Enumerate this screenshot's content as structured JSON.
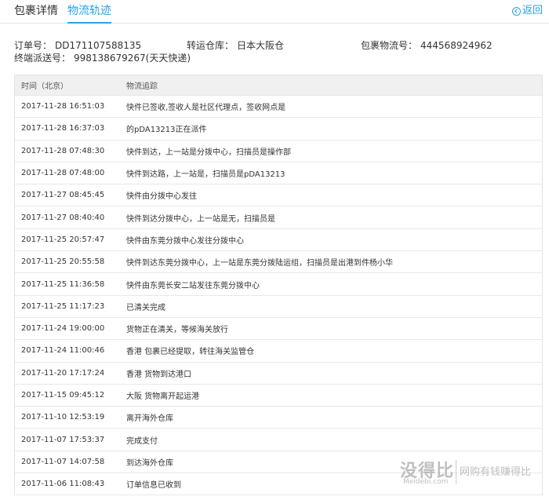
{
  "tabs": [
    {
      "label": "包裹详情"
    },
    {
      "label": "物流轨迹"
    }
  ],
  "back_label": "返回",
  "info": {
    "order_label": "订单号：",
    "order_value": "DD171107588135",
    "warehouse_label": "转运仓库：",
    "warehouse_value": "日本大阪仓",
    "package_label": "包裹物流号：",
    "package_value": "444568924962",
    "terminal_label": "终端派送号：",
    "terminal_value": "998138679267(天天快递)"
  },
  "table": {
    "headers": {
      "time": "时间（北京）",
      "desc": "物流追踪"
    },
    "rows": [
      {
        "time": "2017-11-28 16:51:03",
        "desc": "快件已签收,签收人是社区代理点，签收网点是"
      },
      {
        "time": "2017-11-28 16:37:03",
        "desc": "的pDA13213正在派件"
      },
      {
        "time": "2017-11-28 07:48:30",
        "desc": "快件到达，上一站是分拨中心，扫描员是操作部"
      },
      {
        "time": "2017-11-28 07:48:00",
        "desc": "快件到达路，上一站是，扫描员是pDA13213"
      },
      {
        "time": "2017-11-27 08:45:45",
        "desc": "快件由分拨中心发往"
      },
      {
        "time": "2017-11-27 08:40:40",
        "desc": "快件到达分拨中心，上一站是无，扫描员是"
      },
      {
        "time": "2017-11-25 20:57:47",
        "desc": "快件由东莞分拨中心发往分拨中心"
      },
      {
        "time": "2017-11-25 20:55:58",
        "desc": "快件到达东莞分拨中心，上一站是东莞分拨陆运组，扫描员是出港到件杨小华"
      },
      {
        "time": "2017-11-25 11:36:58",
        "desc": "快件由东莞长安二站发往东莞分拨中心"
      },
      {
        "time": "2017-11-25 11:17:23",
        "desc": "已清关完成"
      },
      {
        "time": "2017-11-24 19:00:00",
        "desc": "货物正在清关，等候海关放行"
      },
      {
        "time": "2017-11-24 11:00:46",
        "desc": "香港 包裹已经提取，转往海关监管仓"
      },
      {
        "time": "2017-11-20 17:17:24",
        "desc": "香港 货物到达港口"
      },
      {
        "time": "2017-11-15 09:45:12",
        "desc": "大阪 货物离开起运港"
      },
      {
        "time": "2017-11-10 12:53:19",
        "desc": "离开海外仓库"
      },
      {
        "time": "2017-11-07 17:53:37",
        "desc": "完成支付"
      },
      {
        "time": "2017-11-07 14:07:58",
        "desc": "到达海外仓库"
      },
      {
        "time": "2017-11-06 11:08:43",
        "desc": "订单信息已收到"
      }
    ]
  },
  "watermark": {
    "main": "没得比",
    "sub": "Meidebi.com",
    "side": "网购有钱赚得比"
  },
  "colors": {
    "accent": "#2aa3e3",
    "header_bg": "#f0f0f0",
    "border": "#e8e8e8"
  },
  "icons": {
    "back": "circle-left-arrow-icon"
  }
}
